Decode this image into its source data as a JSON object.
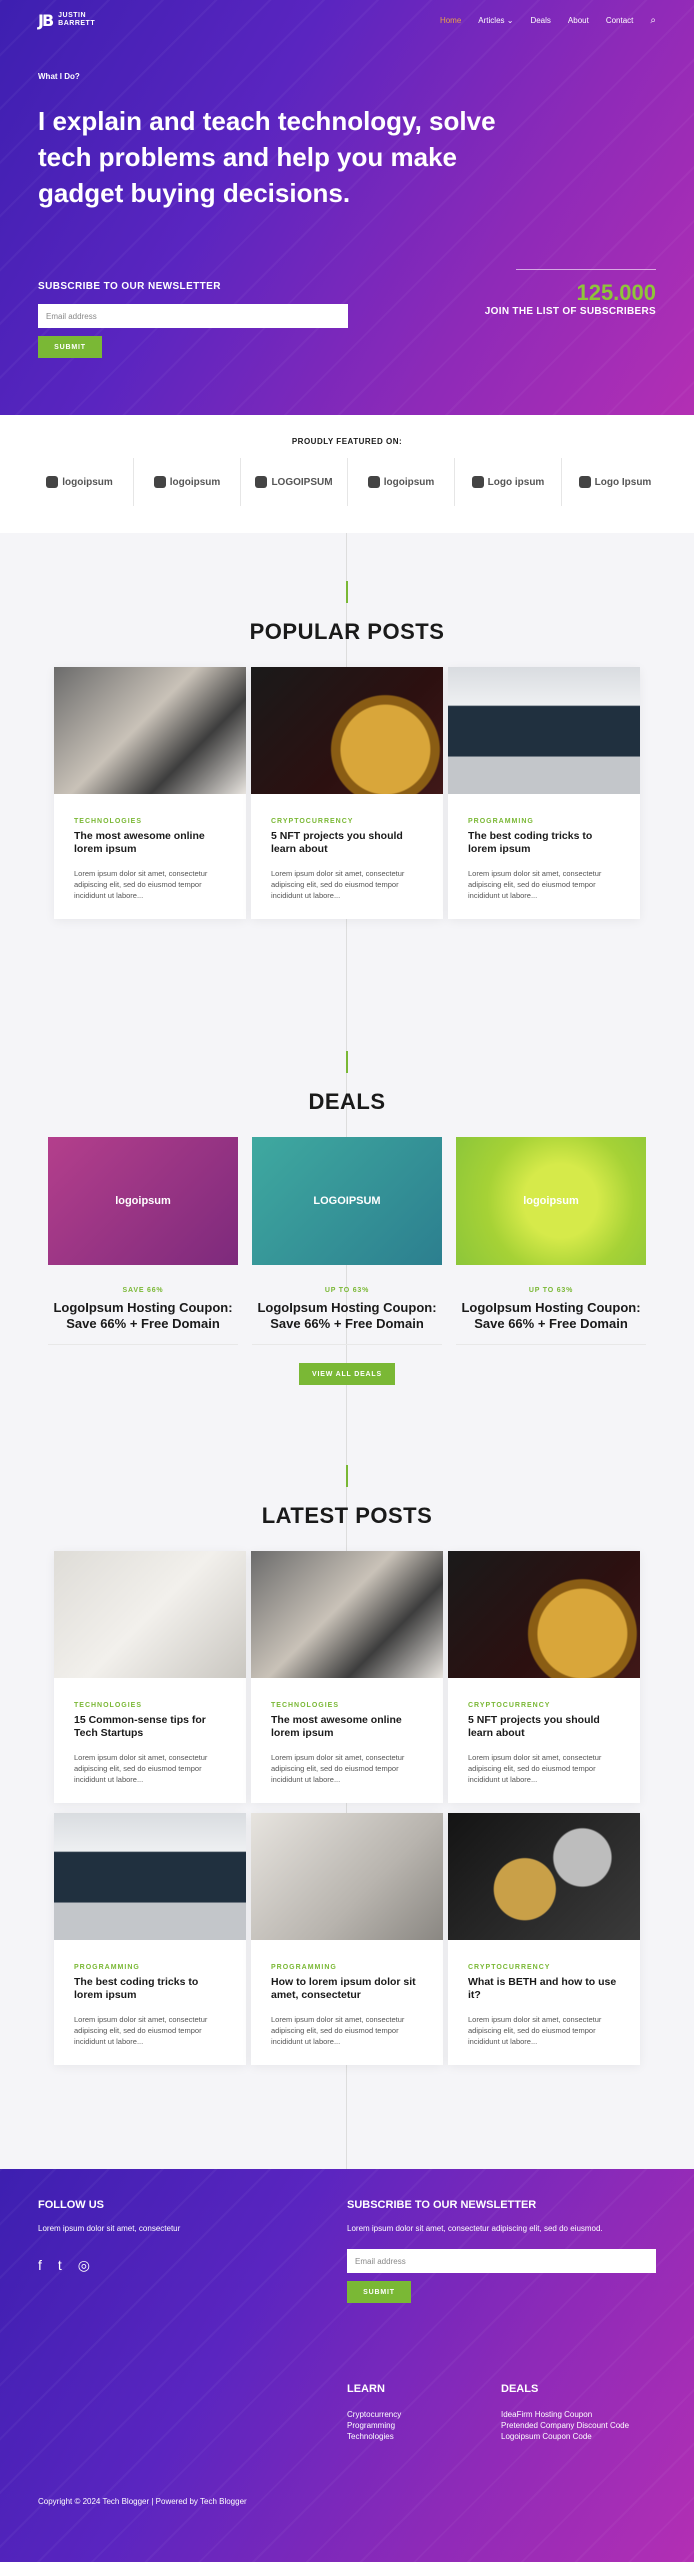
{
  "brand": {
    "mark": "JB",
    "name_line1": "JUSTIN",
    "name_line2": "BARRETT"
  },
  "nav": [
    {
      "label": "Home",
      "active": true
    },
    {
      "label": "Articles ⌄",
      "active": false
    },
    {
      "label": "Deals",
      "active": false
    },
    {
      "label": "About",
      "active": false
    },
    {
      "label": "Contact",
      "active": false
    }
  ],
  "hero": {
    "eyebrow": "What I Do?",
    "headline": "I explain and teach technology, solve tech problems and help you make gadget buying decisions."
  },
  "newsletter": {
    "title": "SUBSCRIBE TO OUR NEWSLETTER",
    "placeholder": "Email address",
    "submit": "SUBMIT"
  },
  "subscribers": {
    "count": "125.000",
    "label": "JOIN THE LIST OF SUBSCRIBERS"
  },
  "featured": {
    "title": "PROUDLY FEATURED ON:",
    "logos": [
      "logoipsum",
      "logoipsum",
      "LOGOIPSUM",
      "logoipsum",
      "Logo ipsum",
      "Logo Ipsum"
    ]
  },
  "popular": {
    "title": "POPULAR POSTS",
    "posts": [
      {
        "category": "TECHNOLOGIES",
        "title": "The most awesome online lorem ipsum",
        "excerpt": "Lorem ipsum dolor sit amet, consectetur adipiscing elit, sed do eiusmod tempor incididunt ut labore...",
        "img": "people"
      },
      {
        "category": "CRYPTOCURRENCY",
        "title": "5 NFT projects you should learn about",
        "excerpt": "Lorem ipsum dolor sit amet, consectetur adipiscing elit, sed do eiusmod tempor incididunt ut labore...",
        "img": "bitcoin"
      },
      {
        "category": "PROGRAMMING",
        "title": "The best coding tricks to lorem ipsum",
        "excerpt": "Lorem ipsum dolor sit amet, consectetur adipiscing elit, sed do eiusmod tempor incididunt ut labore...",
        "img": "code"
      }
    ]
  },
  "deals": {
    "title": "DEALS",
    "items": [
      {
        "logo": "logoipsum",
        "tag": "SAVE 66%",
        "title": "LogoIpsum Hosting Coupon: Save 66% + Free Domain",
        "bg": "pink"
      },
      {
        "logo": "LOGOIPSUM",
        "tag": "UP TO 63%",
        "title": "LogoIpsum Hosting Coupon: Save 66% + Free Domain",
        "bg": "teal"
      },
      {
        "logo": "logoipsum",
        "tag": "UP TO 63%",
        "title": "LogoIpsum Hosting Coupon: Save 66% + Free Domain",
        "bg": "lime"
      }
    ],
    "view_all": "VIEW ALL DEALS"
  },
  "latest": {
    "title": "LATEST POSTS",
    "posts": [
      {
        "category": "TECHNOLOGIES",
        "title": "15 Common-sense tips for Tech Startups",
        "excerpt": "Lorem ipsum dolor sit amet, consectetur adipiscing elit, sed do eiusmod tempor incididunt ut labore...",
        "img": "phone"
      },
      {
        "category": "TECHNOLOGIES",
        "title": "The most awesome online lorem ipsum",
        "excerpt": "Lorem ipsum dolor sit amet, consectetur adipiscing elit, sed do eiusmod tempor incididunt ut labore...",
        "img": "people"
      },
      {
        "category": "CRYPTOCURRENCY",
        "title": "5 NFT projects you should learn about",
        "excerpt": "Lorem ipsum dolor sit amet, consectetur adipiscing elit, sed do eiusmod tempor incididunt ut labore...",
        "img": "bitcoin"
      },
      {
        "category": "PROGRAMMING",
        "title": "The best coding tricks to lorem ipsum",
        "excerpt": "Lorem ipsum dolor sit amet, consectetur adipiscing elit, sed do eiusmod tempor incididunt ut labore...",
        "img": "code"
      },
      {
        "category": "PROGRAMMING",
        "title": "How to lorem ipsum dolor sit amet, consectetur",
        "excerpt": "Lorem ipsum dolor sit amet, consectetur adipiscing elit, sed do eiusmod tempor incididunt ut labore...",
        "img": "laptop"
      },
      {
        "category": "CRYPTOCURRENCY",
        "title": "What is BETH and how to use it?",
        "excerpt": "Lorem ipsum dolor sit amet, consectetur adipiscing elit, sed do eiusmod tempor incididunt ut labore...",
        "img": "coins"
      }
    ]
  },
  "footer": {
    "follow_title": "FOLLOW US",
    "follow_text": "Lorem ipsum dolor sit amet, consectetur",
    "social": [
      "f",
      "t",
      "◎"
    ],
    "newsletter_title": "SUBSCRIBE TO OUR NEWSLETTER",
    "newsletter_text": "Lorem ipsum dolor sit amet, consectetur adipiscing elit, sed do eiusmod.",
    "placeholder": "Email address",
    "submit": "SUBMIT",
    "learn_title": "LEARN",
    "learn": [
      "Cryptocurrency",
      "Programming",
      "Technologies"
    ],
    "deals_title": "DEALS",
    "deals": [
      "IdeaFirm Hosting Coupon",
      "Pretended Company Discount Code",
      "Logoipsum Coupon Code"
    ],
    "copyright": "Copyright © 2024 Tech Blogger | Powered by Tech Blogger"
  },
  "colors": {
    "accent": "#7ab835",
    "gradient_start": "#3d1fb0",
    "gradient_end": "#b32fb4",
    "nav_active": "#e7a24a"
  }
}
